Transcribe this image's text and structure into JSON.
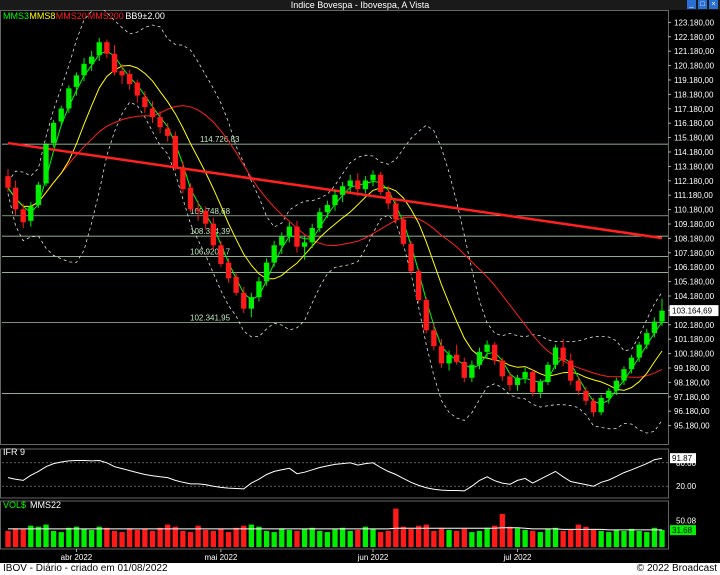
{
  "window": {
    "title": "Indice Bovespa - Ibovespa, A Vista"
  },
  "legend": [
    {
      "label": "MMS3",
      "color": "#00ff00"
    },
    {
      "label": "MMS8",
      "color": "#ffff00"
    },
    {
      "label": "MMS20",
      "color": "#ff2020"
    },
    {
      "label": "MMS200",
      "color": "#ff2020"
    },
    {
      "label": "BB9±2.00",
      "color": "#ffffff"
    }
  ],
  "footer": {
    "left": "IBOV - Diário - criado em 01/08/2022",
    "right": "© 2022 Broadcast"
  },
  "chart_data": {
    "type": "candlestick",
    "ylim": [
      94180,
      123900
    ],
    "yticks": [
      123180,
      122180,
      121180,
      120180,
      119180,
      118180,
      117180,
      116180,
      115180,
      114180,
      113180,
      112180,
      111180,
      110180,
      109180,
      108180,
      107180,
      106180,
      105180,
      104180,
      103180,
      102180,
      101180,
      100180,
      99180,
      98180,
      97180,
      96180,
      95180
    ],
    "ytick_labels": [
      "123.180,00",
      "122.180,00",
      "121.180,00",
      "120.180,00",
      "119.180,00",
      "118.180,00",
      "117.180,00",
      "116.180,00",
      "115.180,00",
      "114.180,00",
      "113.180,00",
      "112.180,00",
      "111.180,00",
      "110.180,00",
      "109.180,00",
      "108.180,00",
      "107.180,00",
      "106.180,00",
      "105.180,00",
      "104.180,00",
      "103.180,00",
      "102.180,00",
      "101.180,00",
      "100.180,00",
      "99.180,00",
      "98.180,00",
      "97.180,00",
      "96.180,00",
      "95.180,00"
    ],
    "last_price": {
      "value": 103164.69,
      "label": "103.164,69"
    },
    "levels": [
      {
        "value": 114726.83,
        "label": "114.726,83"
      },
      {
        "value": 109748.68,
        "label": "109.748,68"
      },
      {
        "value": 108334.39,
        "label": "108.334,39"
      },
      {
        "value": 106920.17,
        "label": "106.920,17"
      },
      {
        "value": 102341.95,
        "label": "102.341,95"
      },
      {
        "value": 105800,
        "label": ""
      },
      {
        "value": 97400,
        "label": ""
      }
    ],
    "months": [
      {
        "label": "abr 2022",
        "index": 9
      },
      {
        "label": "mai 2022",
        "index": 28
      },
      {
        "label": "jun 2022",
        "index": 48
      },
      {
        "label": "jul 2022",
        "index": 67
      }
    ],
    "candles": [
      [
        112500,
        113000,
        111400,
        111700
      ],
      [
        111700,
        112200,
        109800,
        110200
      ],
      [
        110200,
        110600,
        108900,
        109300
      ],
      [
        109400,
        110700,
        109000,
        110400
      ],
      [
        110500,
        112100,
        110300,
        111900
      ],
      [
        112000,
        114800,
        111800,
        114700
      ],
      [
        114800,
        116400,
        114500,
        116200
      ],
      [
        116300,
        117400,
        116000,
        117200
      ],
      [
        117200,
        118800,
        116900,
        118600
      ],
      [
        118700,
        119700,
        118100,
        119500
      ],
      [
        119500,
        120700,
        119100,
        120300
      ],
      [
        120300,
        121200,
        119800,
        120800
      ],
      [
        120900,
        122100,
        120500,
        121800
      ],
      [
        121800,
        122000,
        120700,
        121000
      ],
      [
        121000,
        121600,
        119500,
        119700
      ],
      [
        119800,
        120300,
        118900,
        119500
      ],
      [
        119600,
        119900,
        118500,
        118900
      ],
      [
        119000,
        119200,
        117600,
        118100
      ],
      [
        118000,
        118400,
        116900,
        117300
      ],
      [
        117200,
        117700,
        116200,
        116600
      ],
      [
        116600,
        117000,
        115500,
        115900
      ],
      [
        115800,
        116200,
        114900,
        115300
      ],
      [
        115300,
        115600,
        112900,
        113100
      ],
      [
        113100,
        113500,
        111300,
        111600
      ],
      [
        111700,
        112000,
        110000,
        110200
      ],
      [
        110200,
        110800,
        109400,
        110100
      ],
      [
        110100,
        110400,
        108800,
        109200
      ],
      [
        109200,
        109600,
        107400,
        107700
      ],
      [
        107700,
        108000,
        106200,
        106400
      ],
      [
        106500,
        106800,
        105100,
        105400
      ],
      [
        105500,
        105800,
        104200,
        104400
      ],
      [
        104400,
        104800,
        103000,
        103300
      ],
      [
        103300,
        104400,
        102700,
        104100
      ],
      [
        104100,
        105500,
        103800,
        105200
      ],
      [
        105200,
        106800,
        104900,
        106500
      ],
      [
        106500,
        108000,
        106200,
        107700
      ],
      [
        107700,
        108600,
        107100,
        108300
      ],
      [
        108300,
        109300,
        107900,
        109000
      ],
      [
        109000,
        109400,
        107200,
        107600
      ],
      [
        107600,
        108300,
        106700,
        107900
      ],
      [
        107900,
        109200,
        107500,
        108900
      ],
      [
        108900,
        110300,
        108600,
        110000
      ],
      [
        110000,
        110800,
        109600,
        110500
      ],
      [
        110500,
        111500,
        110100,
        111200
      ],
      [
        111200,
        112100,
        110700,
        111800
      ],
      [
        111800,
        112600,
        111400,
        112200
      ],
      [
        112200,
        112700,
        111100,
        111600
      ],
      [
        111600,
        112500,
        111300,
        112200
      ],
      [
        112200,
        112900,
        111800,
        112600
      ],
      [
        112600,
        112800,
        111200,
        111400
      ],
      [
        111400,
        111800,
        110200,
        110600
      ],
      [
        110600,
        110900,
        109200,
        109500
      ],
      [
        109500,
        109700,
        107600,
        107800
      ],
      [
        107800,
        108000,
        105700,
        105900
      ],
      [
        105900,
        106100,
        103700,
        103900
      ],
      [
        103900,
        104100,
        101600,
        101800
      ],
      [
        101800,
        102300,
        100400,
        100700
      ],
      [
        100700,
        101200,
        99200,
        99500
      ],
      [
        99500,
        100400,
        99000,
        100100
      ],
      [
        100100,
        100800,
        99400,
        99600
      ],
      [
        99600,
        99900,
        98200,
        98500
      ],
      [
        98500,
        99700,
        98200,
        99400
      ],
      [
        99400,
        100600,
        99100,
        100300
      ],
      [
        100300,
        101100,
        99800,
        100800
      ],
      [
        100800,
        101000,
        99400,
        99700
      ],
      [
        99700,
        99900,
        98300,
        98600
      ],
      [
        98600,
        98900,
        97600,
        98000
      ],
      [
        98000,
        98700,
        97600,
        98500
      ],
      [
        98500,
        99200,
        98100,
        98900
      ],
      [
        98900,
        99100,
        97200,
        97500
      ],
      [
        97500,
        98400,
        97100,
        98200
      ],
      [
        98200,
        99600,
        98000,
        99400
      ],
      [
        99400,
        100800,
        99100,
        100600
      ],
      [
        100600,
        101200,
        99300,
        99700
      ],
      [
        99700,
        100200,
        98000,
        98300
      ],
      [
        98300,
        98600,
        97300,
        97600
      ],
      [
        97600,
        97900,
        96600,
        96900
      ],
      [
        96900,
        97100,
        95800,
        96100
      ],
      [
        96100,
        97300,
        95900,
        97100
      ],
      [
        97100,
        97800,
        96700,
        97600
      ],
      [
        97600,
        98500,
        97300,
        98300
      ],
      [
        98300,
        99300,
        98000,
        99100
      ],
      [
        99100,
        100100,
        98800,
        99900
      ],
      [
        99900,
        101000,
        99600,
        100800
      ],
      [
        100800,
        101900,
        100500,
        101600
      ],
      [
        101600,
        102700,
        101300,
        102400
      ],
      [
        102400,
        104000,
        102100,
        103165
      ]
    ],
    "series": [
      {
        "name": "MMS3",
        "color": "#00ff00"
      },
      {
        "name": "MMS8",
        "color": "#ffff00"
      },
      {
        "name": "MMS20",
        "color": "#ff2020"
      },
      {
        "name": "MMS200",
        "color": "#ff2020"
      },
      {
        "name": "BB9±2.00",
        "color": "#ffffff"
      }
    ],
    "mms200": [
      [
        0,
        114800
      ],
      [
        86,
        108200
      ]
    ],
    "ifr": {
      "label": "IFR 9",
      "ylim": [
        0,
        100
      ],
      "ref_lines": [
        80,
        20
      ],
      "tick_labels": [
        "80.00",
        "20.00"
      ],
      "last": {
        "value": 91.87,
        "label": "91.87"
      },
      "values": [
        42,
        38,
        35,
        48,
        58,
        70,
        78,
        82,
        85,
        86,
        86,
        85,
        86,
        80,
        70,
        65,
        60,
        55,
        50,
        47,
        44,
        42,
        35,
        30,
        26,
        26,
        24,
        20,
        17,
        15,
        14,
        13,
        28,
        38,
        50,
        58,
        62,
        66,
        52,
        56,
        62,
        68,
        72,
        76,
        78,
        80,
        74,
        78,
        80,
        68,
        58,
        50,
        40,
        30,
        22,
        16,
        12,
        10,
        9,
        9,
        8,
        20,
        35,
        44,
        34,
        28,
        25,
        35,
        40,
        28,
        38,
        48,
        58,
        44,
        32,
        28,
        24,
        20,
        30,
        36,
        45,
        55,
        62,
        70,
        78,
        88,
        91.87
      ]
    },
    "volume": {
      "label": "VOL$",
      "ma_label": "MMS22",
      "ylim": [
        0,
        75
      ],
      "ref_label": "50.08",
      "last": {
        "value": 31.68,
        "label": "31.68"
      },
      "values": [
        30,
        35,
        33,
        40,
        38,
        42,
        30,
        28,
        36,
        38,
        34,
        32,
        38,
        36,
        30,
        28,
        35,
        32,
        34,
        30,
        36,
        42,
        38,
        30,
        28,
        40,
        32,
        30,
        34,
        28,
        36,
        40,
        42,
        38,
        30,
        28,
        35,
        32,
        30,
        34,
        36,
        30,
        28,
        33,
        36,
        30,
        32,
        38,
        34,
        28,
        30,
        72,
        38,
        34,
        40,
        42,
        30,
        36,
        32,
        30,
        34,
        28,
        30,
        36,
        40,
        62,
        38,
        35,
        32,
        30,
        28,
        34,
        36,
        30,
        32,
        42,
        38,
        34,
        30,
        28,
        32,
        30,
        34,
        30,
        28,
        36,
        32
      ],
      "ma_values": [
        34,
        34,
        34,
        34,
        34,
        34,
        34,
        34,
        34,
        34,
        34,
        34,
        34,
        34,
        34,
        34,
        34,
        34,
        34,
        34,
        34,
        34,
        34,
        34,
        34,
        34,
        34,
        34,
        34,
        34,
        34,
        34,
        34,
        34,
        34,
        34,
        34,
        34,
        34,
        34,
        34,
        34,
        34,
        34,
        34,
        34,
        34,
        34,
        34,
        34,
        34,
        35,
        35,
        35,
        35,
        35,
        35,
        35,
        35,
        35,
        35,
        35,
        35,
        35,
        35,
        36,
        36,
        36,
        35,
        34,
        34,
        34,
        34,
        33,
        33,
        33,
        33,
        33,
        33,
        32,
        32,
        32,
        32,
        32,
        32,
        32,
        32
      ]
    }
  }
}
